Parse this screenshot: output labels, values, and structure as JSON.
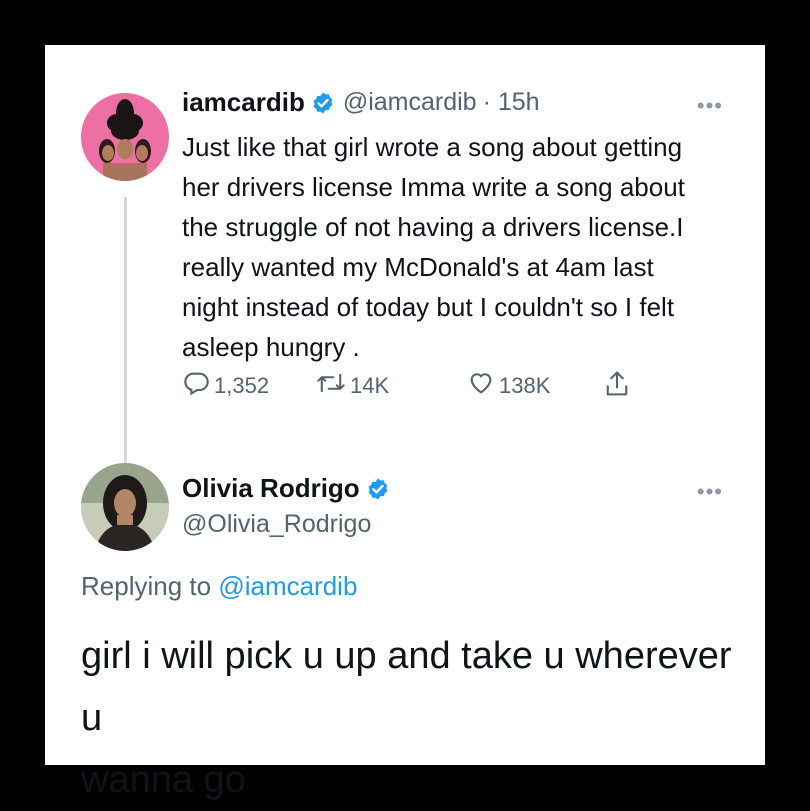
{
  "tweet1": {
    "name": "iamcardib",
    "handle": "@iamcardib",
    "time": "· 15h",
    "text": "Just like that girl wrote a song about getting\nher drivers license Imma write a song about\nthe struggle of not having a drivers license.I\nreally wanted my McDonald's at 4am last\nnight instead of today but I couldn't so I felt\nasleep hungry .",
    "replies": "1,352",
    "retweets": "14K",
    "likes": "138K",
    "more_label": "•••"
  },
  "tweet2": {
    "name": "Olivia Rodrigo",
    "handle": "@Olivia_Rodrigo",
    "replying_prefix": "Replying to",
    "replying_handle": "@iamcardib",
    "text": "girl i will pick u up and take u wherever u\nwanna go",
    "more_label": "•••"
  },
  "icons": {
    "verified": "verified-badge-icon",
    "reply": "reply-icon",
    "retweet": "retweet-icon",
    "like": "heart-icon",
    "share": "share-icon",
    "more": "more-dots-icon"
  },
  "colors": {
    "brand_blue": "#1d9bf0",
    "secondary_text": "#536471",
    "avatar1_bg": "#ee6fa4"
  }
}
